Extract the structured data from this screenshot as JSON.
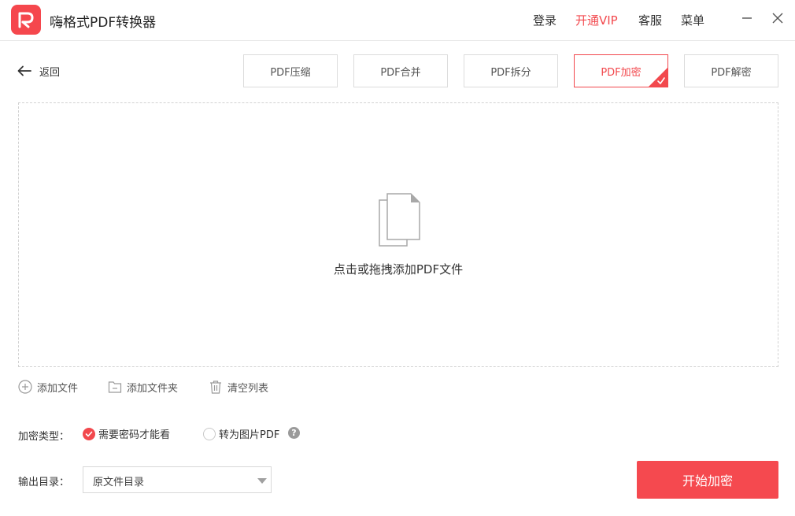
{
  "app": {
    "title": "嗨格式PDF转换器",
    "brand_color": "#f5474d",
    "logo_icon": "pdf-p-logo"
  },
  "header": {
    "login": "登录",
    "vip": "开通VIP",
    "service": "客服",
    "menu": "菜单"
  },
  "window_controls": {
    "minimize_icon": "minimize-icon",
    "close_icon": "close-icon"
  },
  "nav": {
    "back_label": "返回"
  },
  "tabs": [
    {
      "label": "PDF压缩",
      "active": false
    },
    {
      "label": "PDF合并",
      "active": false
    },
    {
      "label": "PDF拆分",
      "active": false
    },
    {
      "label": "PDF加密",
      "active": true
    },
    {
      "label": "PDF解密",
      "active": false
    }
  ],
  "dropzone": {
    "text": "点击或拖拽添加PDF文件",
    "icon": "documents-icon"
  },
  "actions": {
    "add_file": "添加文件",
    "add_folder": "添加文件夹",
    "clear_list": "清空列表"
  },
  "encryption": {
    "label": "加密类型：",
    "options": [
      {
        "label": "需要密码才能看",
        "selected": true
      },
      {
        "label": "转为图片PDF",
        "selected": false
      }
    ],
    "help": "?"
  },
  "output": {
    "label": "输出目录：",
    "value": "原文件目录"
  },
  "start_button": {
    "label": "开始加密",
    "color": "#f5494f"
  }
}
